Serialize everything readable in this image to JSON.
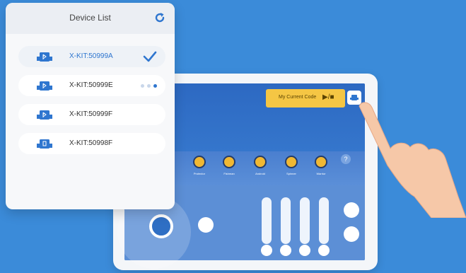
{
  "panel": {
    "title": "Device List",
    "devices": [
      {
        "name": "X-KIT:50999A",
        "status": "connected"
      },
      {
        "name": "X-KIT:50999E",
        "status": "connecting"
      },
      {
        "name": "X-KIT:50999F",
        "status": ""
      },
      {
        "name": "X-KIT:50998F",
        "status": ""
      }
    ]
  },
  "app": {
    "code_block_label": "My Current Code",
    "code_block_controls": "▶/■",
    "tools": [
      {
        "label": "Protector"
      },
      {
        "label": "Fishman"
      },
      {
        "label": "Android"
      },
      {
        "label": "Spinner"
      },
      {
        "label": "Warrior"
      }
    ],
    "help_label": "?"
  },
  "colors": {
    "background": "#3b8bd9",
    "accent": "#2f76cf",
    "code_block": "#f5c644"
  }
}
